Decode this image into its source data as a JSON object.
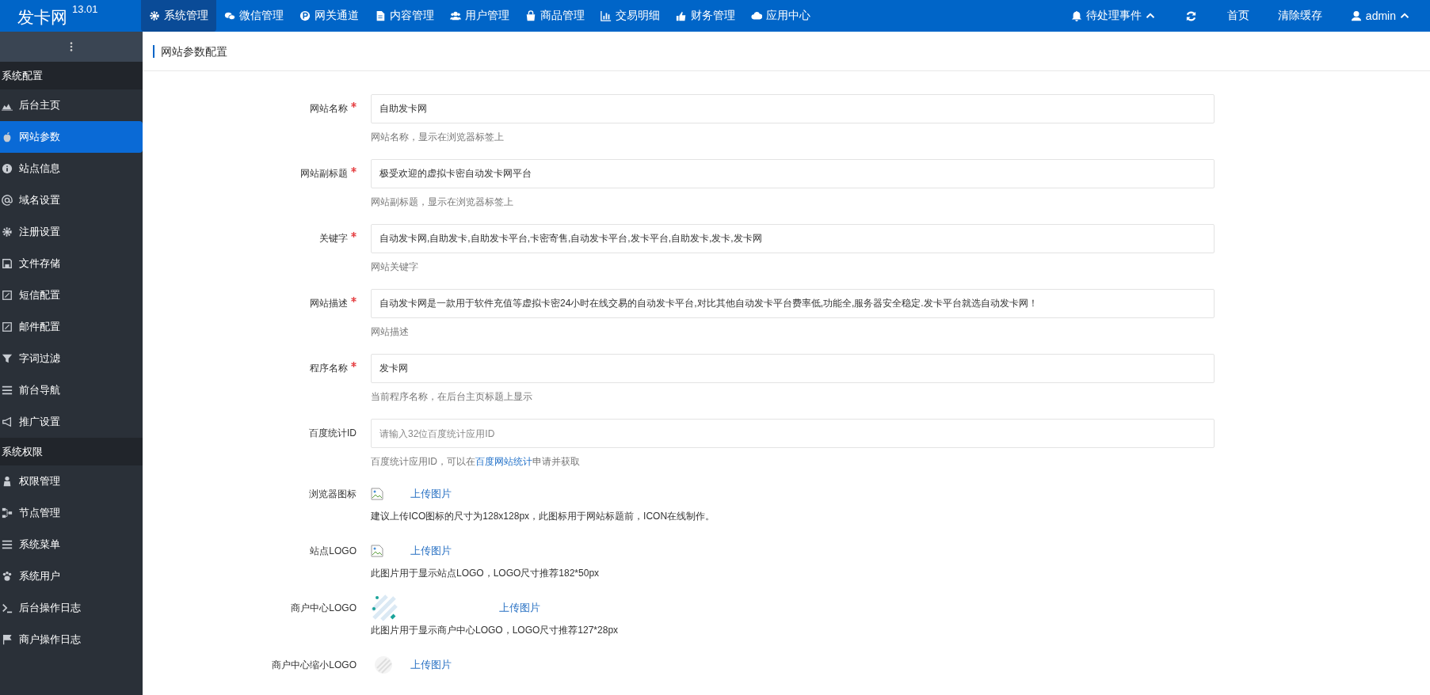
{
  "topbar": {
    "logo": "发卡网",
    "version": "13.01",
    "nav": [
      {
        "label": "系统管理",
        "selected": true
      },
      {
        "label": "微信管理",
        "selected": false
      },
      {
        "label": "网关通道",
        "selected": false
      },
      {
        "label": "内容管理",
        "selected": false
      },
      {
        "label": "用户管理",
        "selected": false
      },
      {
        "label": "商品管理",
        "selected": false
      },
      {
        "label": "交易明细",
        "selected": false
      },
      {
        "label": "财务管理",
        "selected": false
      },
      {
        "label": "应用中心",
        "selected": false
      }
    ],
    "pending": "待处理事件",
    "home": "首页",
    "clear_cache": "清除缓存",
    "user": "admin"
  },
  "sidebar": {
    "sections": [
      {
        "title": "系统配置",
        "items": [
          {
            "label": "后台主页",
            "selected": false
          },
          {
            "label": "网站参数",
            "selected": true
          },
          {
            "label": "站点信息",
            "selected": false
          },
          {
            "label": "域名设置",
            "selected": false
          },
          {
            "label": "注册设置",
            "selected": false
          },
          {
            "label": "文件存储",
            "selected": false
          },
          {
            "label": "短信配置",
            "selected": false
          },
          {
            "label": "邮件配置",
            "selected": false
          },
          {
            "label": "字词过滤",
            "selected": false
          },
          {
            "label": "前台导航",
            "selected": false
          },
          {
            "label": "推广设置",
            "selected": false
          }
        ]
      },
      {
        "title": "系统权限",
        "items": [
          {
            "label": "权限管理",
            "selected": false
          },
          {
            "label": "节点管理",
            "selected": false
          },
          {
            "label": "系统菜单",
            "selected": false
          },
          {
            "label": "系统用户",
            "selected": false
          },
          {
            "label": "后台操作日志",
            "selected": false
          },
          {
            "label": "商户操作日志",
            "selected": false
          }
        ]
      }
    ]
  },
  "page_title": "网站参数配置",
  "fields": [
    {
      "kind": "text",
      "label": "网站名称",
      "required": true,
      "value": "自助发卡网",
      "hint": "网站名称，显示在浏览器标签上"
    },
    {
      "kind": "text",
      "label": "网站副标题",
      "required": true,
      "value": "极受欢迎的虚拟卡密自动发卡网平台",
      "hint": "网站副标题，显示在浏览器标签上"
    },
    {
      "kind": "text",
      "label": "关键字",
      "required": true,
      "value": "自动发卡网,自助发卡,自助发卡平台,卡密寄售,自动发卡平台,发卡平台,自助发卡,发卡,发卡网",
      "hint": "网站关键字"
    },
    {
      "kind": "text",
      "label": "网站描述",
      "required": true,
      "value": "自动发卡网是一款用于软件充值等虚拟卡密24小时在线交易的自动发卡平台,对比其他自动发卡平台费率低,功能全,服务器安全稳定.发卡平台就选自动发卡网！",
      "hint": "网站描述"
    },
    {
      "kind": "text",
      "label": "程序名称",
      "required": true,
      "value": "发卡网",
      "hint": "当前程序名称，在后台主页标题上显示"
    },
    {
      "kind": "text",
      "label": "百度统计ID",
      "required": false,
      "placeholder": "请输入32位百度统计应用ID",
      "hint": "百度统计应用ID，可以在",
      "hint_link": "百度网站统计",
      "hint_after": "申请并获取"
    },
    {
      "kind": "image",
      "label": "浏览器图标",
      "preview": {
        "kind": "broken"
      },
      "upload": "上传图片",
      "hint": "建议上传ICO图标的尺寸为128x128px，此图标用于网站标题前，ICON在线制作。"
    },
    {
      "kind": "image",
      "label": "站点LOGO",
      "preview": {
        "kind": "broken"
      },
      "upload": "上传图片",
      "hint": "此图片用于显示站点LOGO，LOGO尺寸推荐182*50px"
    },
    {
      "kind": "image",
      "label": "商户中心LOGO",
      "preview": {
        "kind": "wide"
      },
      "upload": "上传图片",
      "hint": "此图片用于显示商户中心LOGO，LOGO尺寸推荐127*28px"
    },
    {
      "kind": "image",
      "label": "商户中心缩小LOGO",
      "preview": {
        "kind": "small"
      },
      "upload": "上传图片"
    }
  ]
}
